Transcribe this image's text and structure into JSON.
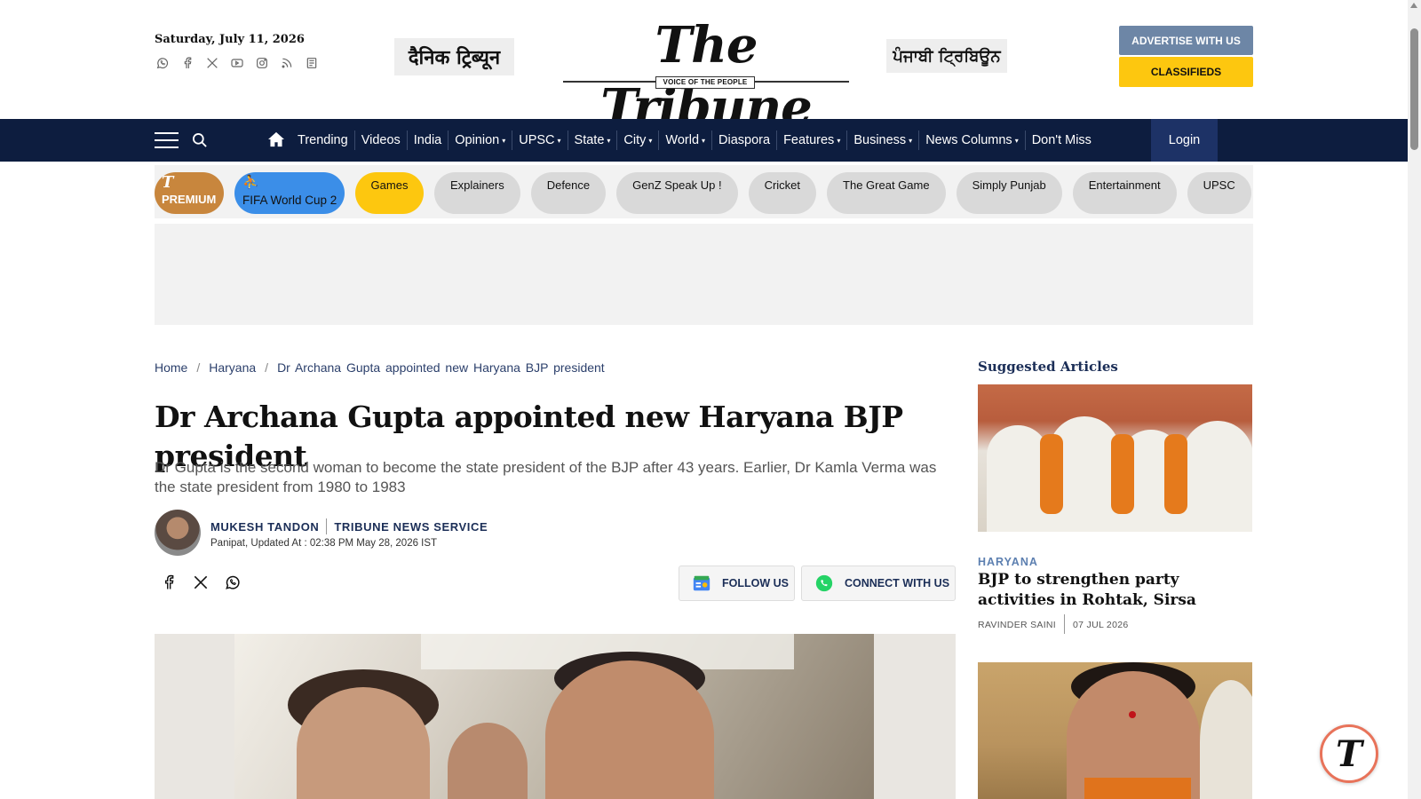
{
  "header": {
    "date": "Saturday, July 11, 2026",
    "social_icons": [
      "whatsapp-icon",
      "facebook-icon",
      "x-icon",
      "youtube-icon",
      "instagram-icon",
      "rss-icon",
      "epaper-icon"
    ],
    "hindi_edition": "दैनिक ट्रिब्यून",
    "brand": "The Tribune",
    "tagline": "VOICE OF THE PEOPLE",
    "punjabi_edition": "ਪੰਜਾਬੀ ਟ੍ਰਿਬਿਊਨ",
    "advertise_label": "ADVERTISE WITH US",
    "classifieds_label": "CLASSIFIEDS",
    "colors": {
      "navy": "#0d1d3f",
      "advertise": "#6d86a6",
      "classifieds": "#fdc70f"
    }
  },
  "nav": {
    "items": [
      {
        "label": "Trending",
        "caret": false
      },
      {
        "label": "Videos",
        "caret": false
      },
      {
        "label": "India",
        "caret": false
      },
      {
        "label": "Opinion",
        "caret": true
      },
      {
        "label": "UPSC",
        "caret": true
      },
      {
        "label": "State",
        "caret": true
      },
      {
        "label": "City",
        "caret": true
      },
      {
        "label": "World",
        "caret": true
      },
      {
        "label": "Diaspora",
        "caret": false
      },
      {
        "label": "Features",
        "caret": true
      },
      {
        "label": "Business",
        "caret": true
      },
      {
        "label": "News Columns",
        "caret": true
      },
      {
        "label": "Don't Miss",
        "caret": false
      }
    ],
    "login_label": "Login",
    "caret_glyph": "▾"
  },
  "chips": {
    "premium_logo": "T",
    "premium_label": "PREMIUM",
    "fifa_label": "FIFA World Cup 2",
    "items": [
      "Games",
      "Explainers",
      "Defence",
      "GenZ Speak Up !",
      "Cricket",
      "The Great Game",
      "Simply Punjab",
      "Entertainment",
      "UPSC"
    ]
  },
  "breadcrumb": {
    "home": "Home",
    "section": "Haryana",
    "current": "Dr Archana Gupta appointed new Haryana BJP president",
    "sep": "/"
  },
  "article": {
    "headline": "Dr Archana Gupta appointed new Haryana BJP president",
    "summary": "Dr Gupta is the second woman to become the state president of the BJP after 43 years. Earlier, Dr Kamla Verma was the state president from 1980 to 1983",
    "author": "MUKESH TANDON",
    "agency": "TRIBUNE NEWS SERVICE",
    "meta": "Panipat, Updated At : 02:38 PM May 28, 2026 IST",
    "follow_label": "FOLLOW US",
    "connect_label": "CONNECT WITH US"
  },
  "sidebar": {
    "title": "Suggested Articles",
    "card1": {
      "category": "HARYANA",
      "headline": "BJP to strengthen party activities in Rohtak, Sirsa",
      "author": "RAVINDER SAINI",
      "date": "07 JUL 2026"
    }
  },
  "floating_logo": "T"
}
